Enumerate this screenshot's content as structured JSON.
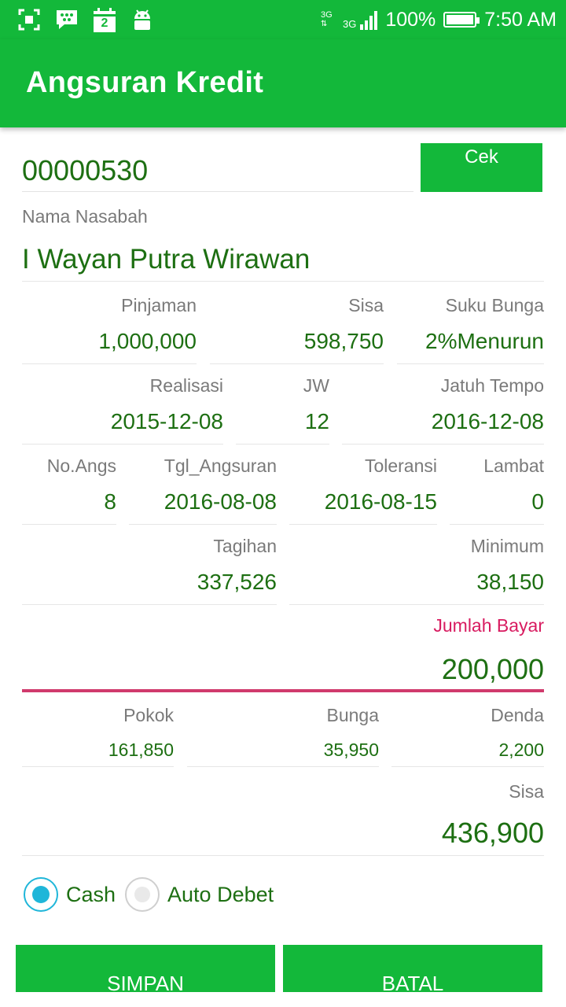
{
  "status_bar": {
    "calendar_day": "2",
    "network": "3G",
    "battery": "100%",
    "time": "7:50 AM"
  },
  "app_bar": {
    "title": "Angsuran Kredit"
  },
  "account": {
    "number": "00000530",
    "check_label": "Cek"
  },
  "nasabah": {
    "label": "Nama Nasabah",
    "value": "I Wayan Putra Wirawan"
  },
  "loan": {
    "pinjaman_label": "Pinjaman",
    "pinjaman": "1,000,000",
    "sisa_label": "Sisa",
    "sisa": "598,750",
    "suku_bunga_label": "Suku Bunga",
    "suku_bunga": "2%Menurun",
    "realisasi_label": "Realisasi",
    "realisasi": "2015-12-08",
    "jw_label": "JW",
    "jw": "12",
    "jatuh_tempo_label": "Jatuh Tempo",
    "jatuh_tempo": "2016-12-08"
  },
  "installment": {
    "no_angs_label": "No.Angs",
    "no_angs": "8",
    "tgl_label": "Tgl_Angsuran",
    "tgl": "2016-08-08",
    "toleransi_label": "Toleransi",
    "toleransi": "2016-08-15",
    "lambat_label": "Lambat",
    "lambat": "0",
    "tagihan_label": "Tagihan",
    "tagihan": "337,526",
    "minimum_label": "Minimum",
    "minimum": "38,150"
  },
  "payment": {
    "jumlah_label": "Jumlah Bayar",
    "jumlah": "200,000",
    "pokok_label": "Pokok",
    "pokok": "161,850",
    "bunga_label": "Bunga",
    "bunga": "35,950",
    "denda_label": "Denda",
    "denda": "2,200",
    "sisa_label": "Sisa",
    "sisa": "436,900"
  },
  "method": {
    "cash_label": "Cash",
    "cash_selected": true,
    "auto_debet_label": "Auto Debet",
    "auto_debet_selected": false
  },
  "actions": {
    "simpan": "SIMPAN",
    "batal": "BATAL"
  },
  "colors": {
    "primary": "#13b83a",
    "value_text": "#1d6f12",
    "accent": "#d81b60",
    "radio": "#1fb6d9"
  }
}
